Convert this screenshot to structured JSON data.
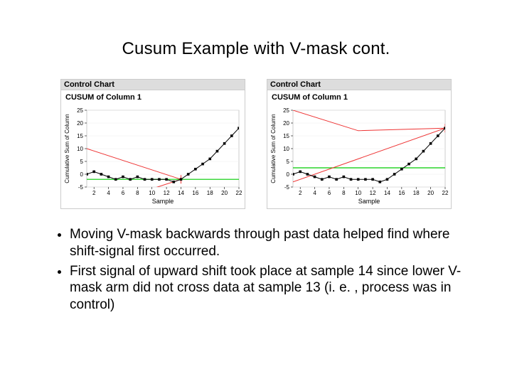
{
  "title": "Cusum Example with V-mask cont.",
  "bullets": [
    "Moving V-mask backwards through past data helped find where shift-signal first occurred.",
    "First signal of upward shift took place at sample 14 since lower V-mask arm did not cross data at sample 13 (i. e. , process was in control)"
  ],
  "panel_labels": {
    "control_chart": "Control Chart",
    "cusum_title": "CUSUM of Column 1",
    "xlabel": "Sample",
    "ylabel": "Cumulative Sum of Column"
  },
  "chart_data": [
    {
      "type": "line",
      "title": "CUSUM of Column 1",
      "xlabel": "Sample",
      "ylabel": "Cumulative Sum of Column",
      "x_ticks": [
        2,
        4,
        6,
        8,
        10,
        12,
        14,
        16,
        18,
        20,
        22
      ],
      "y_ticks": [
        -5,
        0,
        5,
        10,
        15,
        20,
        25
      ],
      "xlim": [
        1,
        22
      ],
      "ylim": [
        -5,
        25
      ],
      "series": [
        {
          "name": "cusum",
          "x": [
            1,
            2,
            3,
            4,
            5,
            6,
            7,
            8,
            9,
            10,
            11,
            12,
            13,
            14,
            15,
            16,
            17,
            18,
            19,
            20,
            21,
            22
          ],
          "values": [
            0,
            1,
            0,
            -1,
            -2,
            -1,
            -2,
            -1,
            -2,
            -2,
            -2,
            -2,
            -3,
            -2,
            0,
            2,
            4,
            6,
            9,
            12,
            15,
            18
          ]
        }
      ],
      "vmask": {
        "vertex_x": 14,
        "vertex_y": -2,
        "upper": [
          [
            1,
            10
          ],
          [
            14,
            -2
          ]
        ],
        "lower": [
          [
            1,
            -14
          ],
          [
            14,
            -2
          ]
        ],
        "ref_y": -2
      }
    },
    {
      "type": "line",
      "title": "CUSUM of Column 1",
      "xlabel": "Sample",
      "ylabel": "Cumulative Sum of Column",
      "x_ticks": [
        2,
        4,
        6,
        8,
        10,
        12,
        14,
        16,
        18,
        20,
        22
      ],
      "y_ticks": [
        -5,
        0,
        5,
        10,
        15,
        20,
        25
      ],
      "xlim": [
        1,
        22
      ],
      "ylim": [
        -5,
        25
      ],
      "series": [
        {
          "name": "cusum",
          "x": [
            1,
            2,
            3,
            4,
            5,
            6,
            7,
            8,
            9,
            10,
            11,
            12,
            13,
            14,
            15,
            16,
            17,
            18,
            19,
            20,
            21,
            22
          ],
          "values": [
            0,
            1,
            0,
            -1,
            -2,
            -1,
            -2,
            -1,
            -2,
            -2,
            -2,
            -2,
            -3,
            -2,
            0,
            2,
            4,
            6,
            9,
            12,
            15,
            18
          ]
        }
      ],
      "vmask": {
        "vertex_x": 22,
        "vertex_y": 18,
        "upper": [
          [
            1,
            25
          ],
          [
            10,
            17
          ],
          [
            22,
            18
          ]
        ],
        "lower": [
          [
            1,
            -3
          ],
          [
            22,
            18
          ]
        ],
        "ref_y": 2.5
      }
    }
  ]
}
